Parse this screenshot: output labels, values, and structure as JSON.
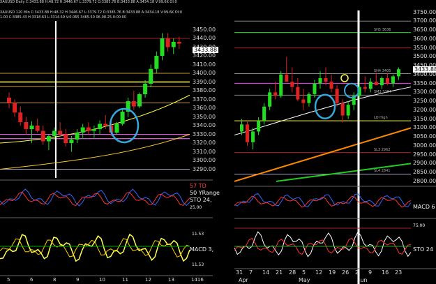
{
  "left": {
    "header1": "XAUUSD Daily C:3433.88 H:48.72 H:3446.67 L:3379.72 O:3385.76 B:3433.88 A:3434.18 V:99.6K OI:0",
    "header2": "XAUUSD 120 Min C:3433.88 H:48.32 H:3446.67 L:3379.72 O:3385.76 B:3433.88 A:3434.18 V:99.6K OI:0",
    "header3": "1.00 C:3385.43 H:3318.63 L:3314.59 V:0.065 3465.50 06-08-25 0:00:00",
    "price_labels": [
      "3450.00",
      "3440.00",
      "3430.00",
      "3420.00",
      "3410.00",
      "3400.00",
      "3390.00",
      "3380.00",
      "3370.00",
      "3360.00",
      "3350.00",
      "3340.00",
      "3330.00",
      "3320.00",
      "3310.00",
      "3300.00",
      "3290.00"
    ],
    "last_price": "3433.88",
    "x_labels": [
      "5",
      "6",
      "8",
      "9",
      "10",
      "11",
      "12",
      "13",
      "1416"
    ],
    "ind1_labels": [
      "57 TD",
      "50 YRange",
      "STO 24,",
      "25.00"
    ],
    "ind2_labels": [
      "11.53",
      "MACD 3,",
      "11.53"
    ],
    "colors": {
      "up": "#22dd22",
      "down": "#dd2222",
      "bg": "#000000"
    }
  },
  "right": {
    "price_labels": [
      "3750.00",
      "3700.00",
      "3650.00",
      "3600.00",
      "3550.00",
      "3500.00",
      "3450.00",
      "3400.00",
      "3350.00",
      "3300.00",
      "3250.00",
      "3200.00",
      "3150.00",
      "3100.00",
      "3050.00",
      "3000.00",
      "2950.00",
      "2900.00",
      "2850.00",
      "2800.00"
    ],
    "last_price": "3433.88",
    "x_labels": [
      "31",
      "7",
      "14",
      "21",
      "28",
      "5",
      "12",
      "19",
      "26",
      "2",
      "9",
      "16",
      "23"
    ],
    "month_labels": [
      "Apr",
      "May",
      "Jun"
    ],
    "level_labels": [
      "SH5 3636",
      "SH4 3405",
      "SM3 3284",
      "LO High",
      "SL3 2962",
      "SL4 2841"
    ],
    "ind1_label": "MACD 6",
    "ind2_labels": [
      "75.00",
      "STO 24"
    ]
  },
  "chart_data": [
    {
      "type": "candlestick",
      "title": "XAUUSD 120 Min",
      "ylim": [
        3280,
        3460
      ],
      "ohlc": [
        [
          3372,
          3378,
          3360,
          3366
        ],
        [
          3366,
          3370,
          3350,
          3355
        ],
        [
          3355,
          3362,
          3340,
          3344
        ],
        [
          3344,
          3350,
          3330,
          3336
        ],
        [
          3336,
          3345,
          3320,
          3340
        ],
        [
          3340,
          3348,
          3332,
          3334
        ],
        [
          3334,
          3340,
          3318,
          3322
        ],
        [
          3322,
          3330,
          3312,
          3328
        ],
        [
          3328,
          3338,
          3324,
          3334
        ],
        [
          3334,
          3344,
          3328,
          3330
        ],
        [
          3330,
          3336,
          3316,
          3320
        ],
        [
          3320,
          3328,
          3310,
          3324
        ],
        [
          3324,
          3336,
          3320,
          3332
        ],
        [
          3332,
          3342,
          3326,
          3338
        ],
        [
          3338,
          3344,
          3330,
          3334
        ],
        [
          3334,
          3340,
          3326,
          3336
        ],
        [
          3336,
          3346,
          3330,
          3342
        ],
        [
          3342,
          3352,
          3336,
          3340
        ],
        [
          3340,
          3346,
          3328,
          3332
        ],
        [
          3332,
          3344,
          3330,
          3342
        ],
        [
          3342,
          3360,
          3340,
          3356
        ],
        [
          3356,
          3372,
          3350,
          3368
        ],
        [
          3368,
          3380,
          3358,
          3362
        ],
        [
          3362,
          3378,
          3360,
          3376
        ],
        [
          3376,
          3392,
          3372,
          3388
        ],
        [
          3388,
          3410,
          3384,
          3405
        ],
        [
          3405,
          3425,
          3400,
          3420
        ],
        [
          3420,
          3446,
          3415,
          3440
        ],
        [
          3440,
          3446,
          3425,
          3430
        ],
        [
          3430,
          3440,
          3422,
          3436
        ],
        [
          3436,
          3442,
          3428,
          3434
        ]
      ]
    },
    {
      "type": "candlestick",
      "title": "XAUUSD Daily",
      "ylim": [
        2780,
        3760
      ],
      "ohlc": [
        [
          3080,
          3150,
          3060,
          3120
        ],
        [
          3120,
          3140,
          3000,
          3020
        ],
        [
          3020,
          3100,
          2980,
          3080
        ],
        [
          3080,
          3160,
          3060,
          3140
        ],
        [
          3140,
          3240,
          3120,
          3220
        ],
        [
          3220,
          3320,
          3200,
          3300
        ],
        [
          3300,
          3360,
          3260,
          3280
        ],
        [
          3280,
          3420,
          3270,
          3400
        ],
        [
          3400,
          3500,
          3380,
          3360
        ],
        [
          3360,
          3440,
          3300,
          3330
        ],
        [
          3330,
          3380,
          3250,
          3260
        ],
        [
          3260,
          3320,
          3200,
          3240
        ],
        [
          3240,
          3300,
          3220,
          3290
        ],
        [
          3290,
          3370,
          3270,
          3350
        ],
        [
          3350,
          3420,
          3320,
          3380
        ],
        [
          3380,
          3440,
          3340,
          3360
        ],
        [
          3360,
          3400,
          3300,
          3320
        ],
        [
          3320,
          3340,
          3220,
          3240
        ],
        [
          3240,
          3260,
          3130,
          3170
        ],
        [
          3170,
          3250,
          3150,
          3230
        ],
        [
          3230,
          3300,
          3200,
          3280
        ],
        [
          3280,
          3360,
          3260,
          3330
        ],
        [
          3330,
          3390,
          3300,
          3320
        ],
        [
          3320,
          3380,
          3300,
          3360
        ],
        [
          3360,
          3410,
          3340,
          3340
        ],
        [
          3340,
          3390,
          3320,
          3380
        ],
        [
          3380,
          3410,
          3340,
          3350
        ],
        [
          3350,
          3400,
          3330,
          3390
        ],
        [
          3390,
          3440,
          3370,
          3430
        ]
      ]
    }
  ]
}
